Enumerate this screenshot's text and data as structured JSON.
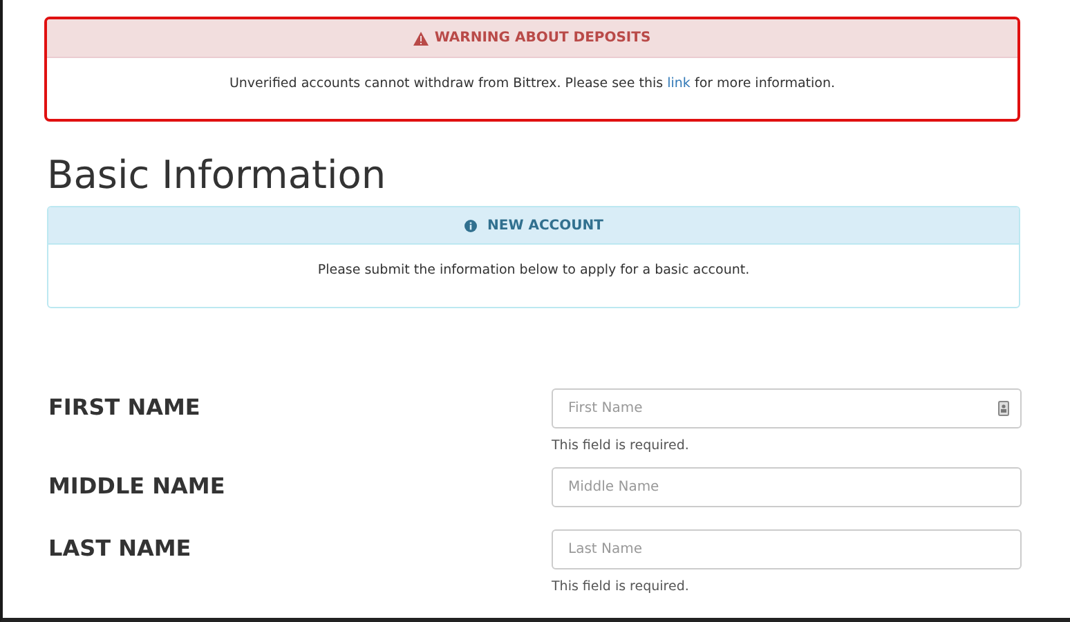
{
  "warning": {
    "title": "WARNING ABOUT DEPOSITS",
    "text_before": "Unverified accounts cannot withdraw from Bittrex. Please see this",
    "link": "link",
    "text_after": "for more information."
  },
  "heading": "Basic Information",
  "info": {
    "title": "NEW ACCOUNT",
    "text": "Please submit the information below to apply for a basic account."
  },
  "fields": [
    {
      "label": "FIRST NAME",
      "placeholder": "First Name",
      "autofill_icon": true,
      "error": "This field is required."
    },
    {
      "label": "MIDDLE NAME",
      "placeholder": "Middle Name",
      "autofill_icon": false
    },
    {
      "label": "LAST NAME",
      "placeholder": "Last Name",
      "autofill_icon": false,
      "error": "This field is required."
    }
  ]
}
